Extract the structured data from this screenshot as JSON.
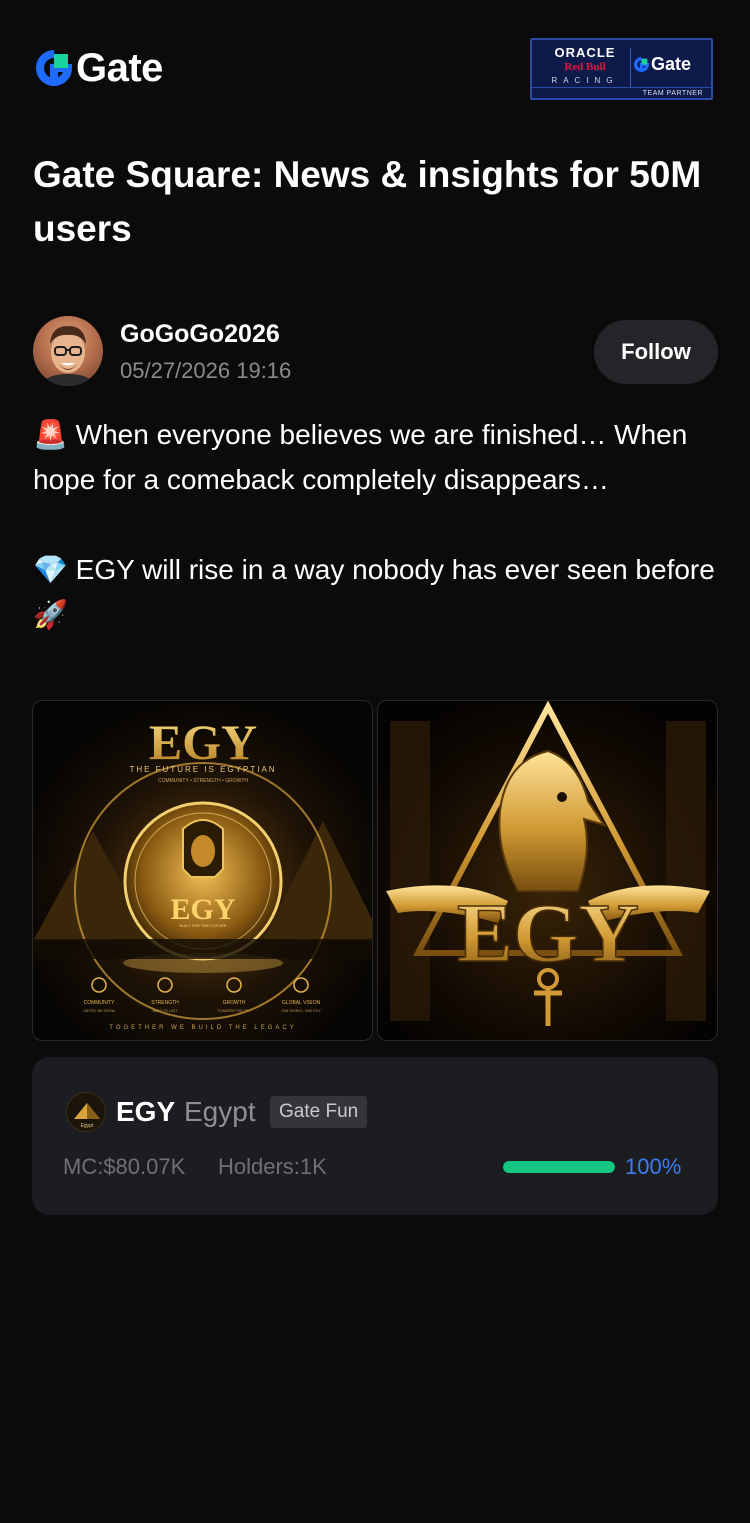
{
  "header": {
    "logo_text": "Gate",
    "partner_badge": {
      "oracle": "ORACLE",
      "redbull": "Red Bull",
      "racing": "RACING",
      "brand": "Gate",
      "tagline": "TEAM PARTNER"
    }
  },
  "page": {
    "title": "Gate Square: News & insights for 50M users"
  },
  "author": {
    "name": "GoGoGo2026",
    "timestamp": "05/27/2026 19:16",
    "follow_label": "Follow"
  },
  "post": {
    "paragraph1_emoji": "🚨",
    "paragraph1_text": "When everyone believes we are finished… When hope for a comeback completely disappears…",
    "paragraph2_emoji": "💎",
    "paragraph2_text": "EGY will rise in a way nobody has ever seen before",
    "paragraph2_trailing_emoji": "🚀"
  },
  "images": [
    {
      "title": "EGY",
      "tagline": "THE FUTURE IS EGYPTIAN",
      "subtagline": "COMMUNITY • STRENGTH • GROWTH",
      "coin_text": "EGY",
      "coin_sub": "BUILT FOR THE FUTURE",
      "features": [
        {
          "label": "COMMUNITY",
          "sub": "UNITED WE GROW"
        },
        {
          "label": "STRENGTH",
          "sub": "BUILT TO LAST"
        },
        {
          "label": "GROWTH",
          "sub": "TOWARDS THE TOP"
        },
        {
          "label": "GLOBAL VISION",
          "sub": "ONE WORLD. ONE EGY"
        }
      ],
      "footer": "TOGETHER WE BUILD THE LEGACY"
    },
    {
      "title": "EGY"
    }
  ],
  "token": {
    "icon_caption": "Egypt",
    "symbol": "EGY",
    "name": "Egypt",
    "badge": "Gate Fun",
    "market_cap": "MC:$80.07K",
    "holders": "Holders:1K",
    "progress_percent": 100,
    "progress_label": "100%"
  },
  "colors": {
    "background": "#0b0b0c",
    "card": "#1c1d21",
    "progress_fill": "#16c784",
    "progress_text": "#3a7cf6",
    "brand_blue": "#1f6bff",
    "brand_green": "#18d39e"
  }
}
